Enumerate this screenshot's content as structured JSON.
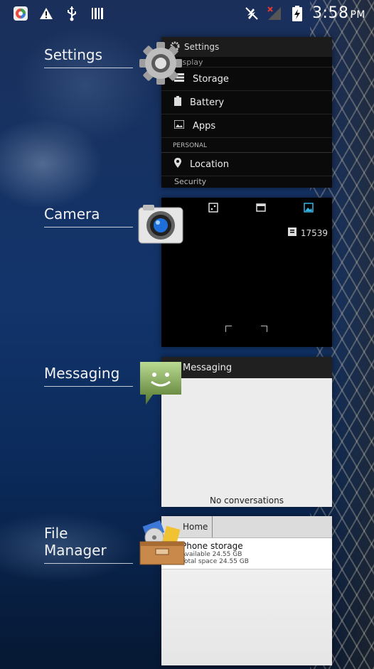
{
  "status_bar": {
    "time": "3:58",
    "ampm": "PM"
  },
  "recents": [
    {
      "label": "Settings",
      "thumbnail": {
        "title": "Settings",
        "partial_row": "Display",
        "rows": [
          "Storage",
          "Battery",
          "Apps"
        ],
        "section_header": "PERSONAL",
        "rows2": [
          "Location"
        ],
        "partial_row2": "Security"
      }
    },
    {
      "label": "Camera",
      "thumbnail": {
        "count": "17539"
      }
    },
    {
      "label": "Messaging",
      "thumbnail": {
        "title": "Messaging",
        "empty_text": "No conversations"
      }
    },
    {
      "label": "File Manager",
      "thumbnail": {
        "crumb": "Home",
        "storage_name": "Phone storage",
        "available": "Available 24.55 GB",
        "total": "Total space 24.55 GB"
      }
    }
  ]
}
